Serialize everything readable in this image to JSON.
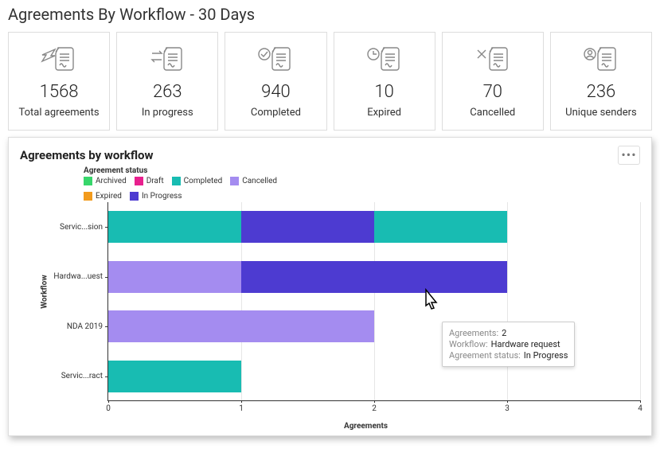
{
  "title": "Agreements By Workflow - 30 Days",
  "stats": [
    {
      "icon": "send",
      "value": "1568",
      "label": "Total agreements"
    },
    {
      "icon": "progress",
      "value": "263",
      "label": "In progress"
    },
    {
      "icon": "completed",
      "value": "940",
      "label": "Completed"
    },
    {
      "icon": "expired",
      "value": "10",
      "label": "Expired"
    },
    {
      "icon": "cancelled",
      "value": "70",
      "label": "Cancelled"
    },
    {
      "icon": "user",
      "value": "236",
      "label": "Unique senders"
    }
  ],
  "chart": {
    "title": "Agreements by workflow",
    "legend_title": "Agreement status",
    "xlabel": "Agreements",
    "ylabel": "Workflow",
    "ticks": [
      "0",
      "1",
      "2",
      "3",
      "4"
    ],
    "categories_display": [
      "Servic...sion",
      "Hardwa...uest",
      "NDA 2019",
      "Servic...ract"
    ],
    "tooltip": {
      "k1": "Agreements:",
      "v1": "2",
      "k2": "Workflow:",
      "v2": "Hardware request",
      "k3": "Agreement status:",
      "v3": "In Progress"
    }
  },
  "colors": {
    "archived": "#37d66b",
    "draft": "#e8208e",
    "completed": "#18bcb2",
    "cancelled": "#a48cf0",
    "expired": "#f29b1d",
    "in_progress": "#4d3bd1"
  },
  "legend_items": [
    {
      "label": "Archived",
      "color_key": "archived"
    },
    {
      "label": "Draft",
      "color_key": "draft"
    },
    {
      "label": "Completed",
      "color_key": "completed"
    },
    {
      "label": "Cancelled",
      "color_key": "cancelled"
    },
    {
      "label": "Expired",
      "color_key": "expired"
    },
    {
      "label": "In Progress",
      "color_key": "in_progress"
    }
  ],
  "chart_data": {
    "type": "bar",
    "orientation": "horizontal",
    "stacked": true,
    "title": "Agreements by workflow",
    "xlabel": "Agreements",
    "ylabel": "Workflow",
    "xlim": [
      0,
      4
    ],
    "categories": [
      "Service permission",
      "Hardware request",
      "NDA 2019",
      "Service contract"
    ],
    "series": [
      {
        "name": "Archived",
        "color": "#37d66b",
        "values": [
          0,
          0,
          0,
          0
        ]
      },
      {
        "name": "Draft",
        "color": "#e8208e",
        "values": [
          0,
          0,
          0,
          0
        ]
      },
      {
        "name": "Completed",
        "color": "#18bcb2",
        "values": [
          1,
          0,
          0,
          1
        ]
      },
      {
        "name": "Cancelled",
        "color": "#a48cf0",
        "values": [
          0,
          1,
          2,
          0
        ]
      },
      {
        "name": "Expired",
        "color": "#f29b1d",
        "values": [
          0,
          0,
          0,
          0
        ]
      },
      {
        "name": "In Progress",
        "color": "#4d3bd1",
        "values": [
          1,
          2,
          0,
          0
        ]
      }
    ],
    "overflow_segments": [
      {
        "category_index": 0,
        "name": "Completed",
        "color": "#18bcb2",
        "value": 1
      }
    ],
    "legend_position": "top-left"
  }
}
